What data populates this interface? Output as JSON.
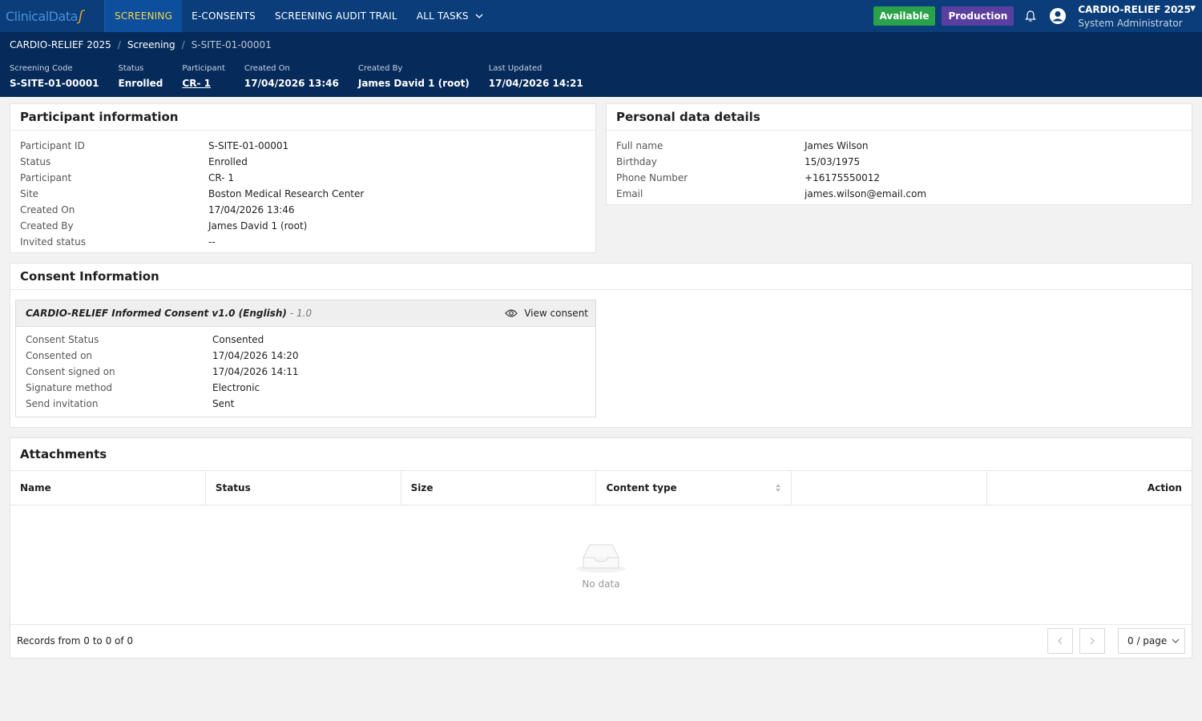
{
  "nav": {
    "logo": "ClinicalData",
    "items": [
      {
        "label": "SCREENING",
        "active": true
      },
      {
        "label": "E-CONSENTS",
        "active": false
      },
      {
        "label": "SCREENING AUDIT TRAIL",
        "active": false
      },
      {
        "label": "ALL TASKS",
        "active": false
      }
    ],
    "status_badge": "Available",
    "env_badge": "Production",
    "user_study": "CARDIO-RELIEF 2025",
    "user_role": "System Administrator"
  },
  "breadcrumb": [
    "CARDIO-RELIEF 2025",
    "Screening",
    "S-SITE-01-00001"
  ],
  "summary": [
    {
      "label": "Screening Code",
      "value": "S-SITE-01-00001"
    },
    {
      "label": "Status",
      "value": "Enrolled"
    },
    {
      "label": "Participant",
      "value": "CR- 1"
    },
    {
      "label": "Created On",
      "value": "17/04/2026 13:46"
    },
    {
      "label": "Created By",
      "value": "James David 1 (root)"
    },
    {
      "label": "Last Updated",
      "value": "17/04/2026 14:21"
    }
  ],
  "participant": {
    "title": "Participant information",
    "rows": [
      {
        "k": "Participant ID",
        "v": "S-SITE-01-00001"
      },
      {
        "k": "Status",
        "v": "Enrolled"
      },
      {
        "k": "Participant",
        "v": "CR- 1"
      },
      {
        "k": "Site",
        "v": "Boston Medical Research Center"
      },
      {
        "k": "Created On",
        "v": "17/04/2026 13:46"
      },
      {
        "k": "Created By",
        "v": "James David 1 (root)"
      },
      {
        "k": "Invited status",
        "v": "--"
      }
    ]
  },
  "personal": {
    "title": "Personal data details",
    "rows": [
      {
        "k": "Full name",
        "v": "James Wilson"
      },
      {
        "k": "Birthday",
        "v": "15/03/1975"
      },
      {
        "k": "Phone Number",
        "v": "+16175550012"
      },
      {
        "k": "Email",
        "v": "james.wilson@email.com"
      }
    ]
  },
  "consent": {
    "title": "Consent Information",
    "form_name": "CARDIO-RELIEF Informed Consent v1.0 (English)",
    "form_version": "- 1.0",
    "view_label": "View consent",
    "rows": [
      {
        "k": "Consent Status",
        "v": "Consented"
      },
      {
        "k": "Consented on",
        "v": "17/04/2026 14:20"
      },
      {
        "k": "Consent signed on",
        "v": "17/04/2026 14:11"
      },
      {
        "k": "Signature method",
        "v": "Electronic"
      },
      {
        "k": "Send invitation",
        "v": "Sent"
      }
    ]
  },
  "attachments": {
    "title": "Attachments",
    "columns": [
      "Name",
      "Status",
      "Size",
      "Content type",
      "",
      "Action"
    ],
    "empty_text": "No data",
    "records_text": "Records from 0 to 0 of 0",
    "page_size": "0 / page"
  }
}
